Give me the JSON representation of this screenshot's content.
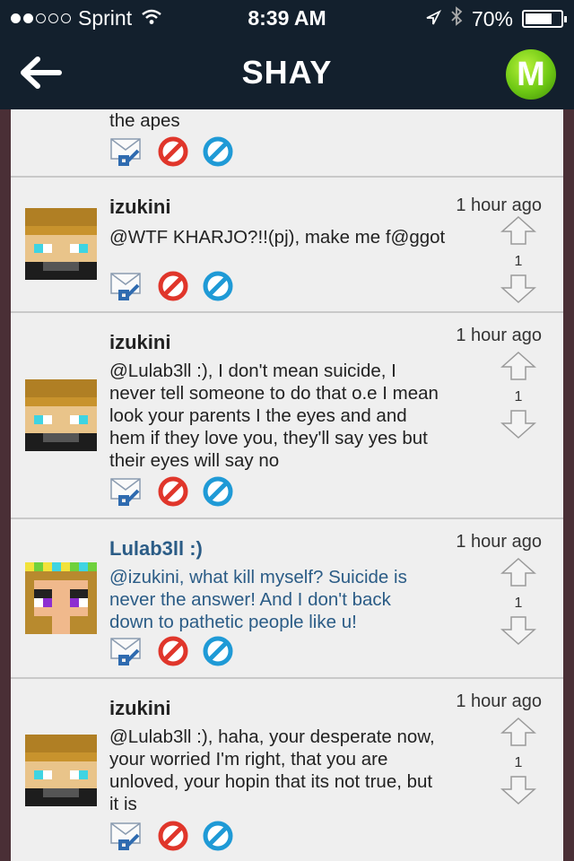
{
  "status_bar": {
    "carrier": "Sprint",
    "time": "8:39 AM",
    "battery": "70%",
    "signal_bars": 2
  },
  "header": {
    "title": "SHAY",
    "logo_letter": "M"
  },
  "partial_post": {
    "text": "the apes"
  },
  "posts": [
    {
      "username": "izukini",
      "time": "1 hour ago",
      "text": "@WTF KHARJO?!!(pj), make me f@ggot",
      "votes": "1",
      "style": "normal"
    },
    {
      "username": "izukini",
      "time": "1 hour ago",
      "lines": [
        "@Lulab3ll :), I don't mean suicide, I",
        "never tell someone to do that o.e I mean",
        "look your parents I the eyes and and",
        "hem if they love you, they'll say yes but",
        "their eyes will say no"
      ],
      "votes": "1",
      "style": "normal"
    },
    {
      "username": "Lulab3ll :)",
      "time": "1 hour ago",
      "lines": [
        "@izukini, what kill myself? Suicide is",
        "never the answer! And I don't back",
        "down to pathetic people like u!"
      ],
      "votes": "1",
      "style": "blue"
    },
    {
      "username": "izukini",
      "time": "1 hour ago",
      "lines": [
        "@Lulab3ll :), haha, your desperate now,",
        "your worried I'm right, that you are",
        "unloved, your hopin that its not true, but",
        "it is"
      ],
      "votes": "1",
      "style": "normal"
    }
  ],
  "icons": {
    "reply": "reply-mail-icon",
    "report": "report-red-prohibit-icon",
    "block": "block-blue-prohibit-icon",
    "upvote": "upvote-arrow-icon",
    "downvote": "downvote-arrow-icon"
  },
  "colors": {
    "header_bg": "#13202d",
    "content_bg": "#efefef",
    "highlight_text": "#2b5c86",
    "logo_green": "#6ec814"
  }
}
